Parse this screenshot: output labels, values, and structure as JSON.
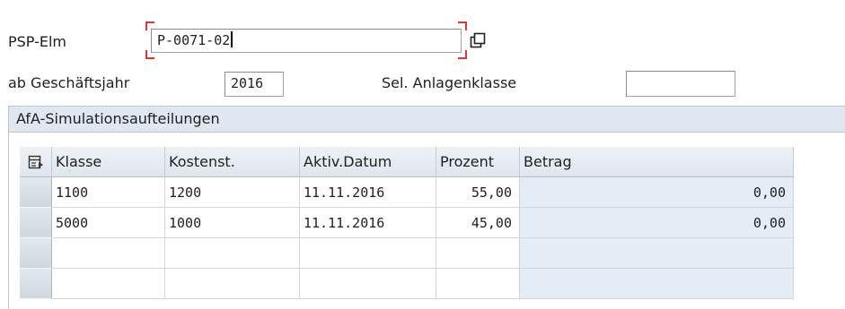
{
  "header": {
    "psp_label": "PSP-Elm",
    "psp_value": "P-0071-02",
    "year_label": "ab Geschäftsjahr",
    "year_value": "2016",
    "class_label": "Sel. Anlagenklasse",
    "class_value": ""
  },
  "group": {
    "title": "AfA-Simulationsaufteilungen"
  },
  "table": {
    "columns": [
      "Klasse",
      "Kostenst.",
      "Aktiv.Datum",
      "Prozent",
      "Betrag"
    ],
    "rows": [
      {
        "klasse": "1100",
        "kostenst": "1200",
        "datum": "11.11.2016",
        "prozent": "55,00",
        "betrag": "0,00"
      },
      {
        "klasse": "5000",
        "kostenst": "1000",
        "datum": "11.11.2016",
        "prozent": "45,00",
        "betrag": "0,00"
      },
      {
        "klasse": "",
        "kostenst": "",
        "datum": "",
        "prozent": "",
        "betrag": ""
      },
      {
        "klasse": "",
        "kostenst": "",
        "datum": "",
        "prozent": "",
        "betrag": ""
      }
    ]
  },
  "icons": {
    "f4": "value-help-icon",
    "select_all": "column-settings-icon"
  }
}
